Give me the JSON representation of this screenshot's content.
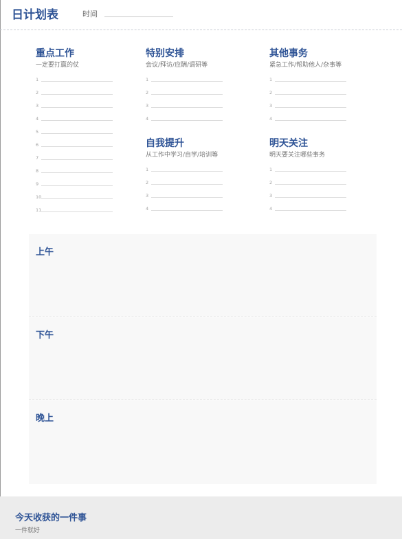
{
  "header": {
    "title": "日计划表",
    "time_label": "时间"
  },
  "sections": {
    "key_work": {
      "title": "重点工作",
      "subtitle": "一定要打赢的仗",
      "numbers": [
        "1",
        "2",
        "3",
        "4",
        "5",
        "6",
        "7",
        "8",
        "9",
        "10",
        "11"
      ]
    },
    "special": {
      "title": "特别安排",
      "subtitle": "会议/拜访/应酬/调研等",
      "numbers": [
        "1",
        "2",
        "3",
        "4"
      ]
    },
    "other": {
      "title": "其他事务",
      "subtitle": "紧急工作/帮助他人/杂事等",
      "numbers": [
        "1",
        "2",
        "3",
        "4"
      ]
    },
    "improve": {
      "title": "自我提升",
      "subtitle": "从工作中学习/自学/培训等",
      "numbers": [
        "1",
        "2",
        "3",
        "4"
      ]
    },
    "tomorrow": {
      "title": "明天关注",
      "subtitle": "明天要关注哪些事务",
      "numbers": [
        "1",
        "2",
        "3",
        "4"
      ]
    }
  },
  "blocks": {
    "morning": "上午",
    "afternoon": "下午",
    "evening": "晚上"
  },
  "footer": {
    "title": "今天收获的一件事",
    "subtitle": "一件就好"
  }
}
